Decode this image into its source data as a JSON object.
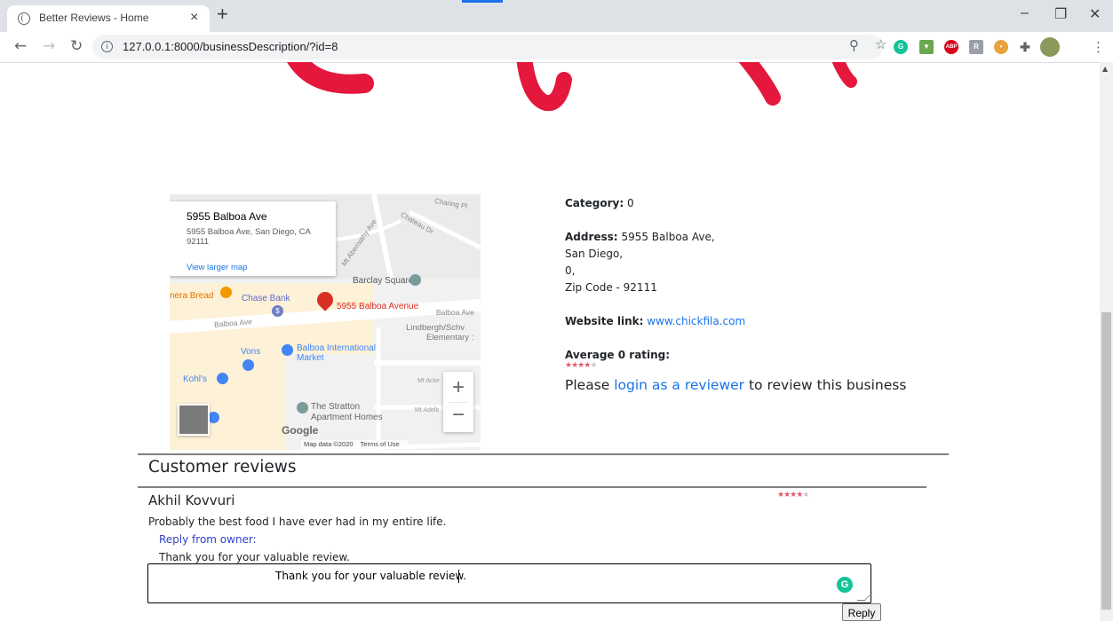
{
  "browser": {
    "tab_title": "Better Reviews - Home",
    "tab_close": "×",
    "new_tab": "+",
    "url": "127.0.0.1:8000/businessDescription/?id=8",
    "window_minimize": "–",
    "window_restore": "❐",
    "window_close": "✕",
    "extensions": [
      "grammarly-icon",
      "downloader-icon",
      "adblock-icon",
      "translate-icon",
      "cookie-icon",
      "puzzle-icon",
      "profile-avatar"
    ],
    "adblock_label": "ABP"
  },
  "map": {
    "card_title": "5955 Balboa Ave",
    "card_address": "5955 Balboa Ave, San Diego, CA 92111",
    "card_link": "View larger map",
    "pin_label": "5955 Balboa Avenue",
    "places": {
      "barclay": "Barclay Square",
      "chase": "Chase Bank",
      "panera": "nera Bread",
      "balboa_ave_left": "Balboa Ave",
      "balboa_ave_right": "Balboa Ave",
      "lindbergh": "Lindbergh/Schv",
      "elementary": "Elementary :",
      "vons": "Vons",
      "balboa_market": "Balboa International",
      "market": "Market",
      "kohls": "Kohl's",
      "stratton1": "The Stratton",
      "stratton2": "Apartment Homes",
      "charing": "Charing Pl",
      "chateau": "Chateau Dr",
      "abernathy": "Mt Abernathy Ave",
      "mt_acke": "Mt Acke",
      "mt_adelb": "Mt Adelb"
    },
    "google": "Google",
    "map_data": "Map data ©2020",
    "terms": "Terms of Use"
  },
  "business": {
    "category_label": "Category:",
    "category_value": "0",
    "address_label": "Address:",
    "address_line1": "5955 Balboa Ave,",
    "address_line2": "San Diego,",
    "address_line3": "0,",
    "address_line4": "Zip Code - 92111",
    "website_label": "Website link:",
    "website_value": "www.chickfila.com",
    "rating_label": "Average 0 rating:",
    "rating_stars": 3.5,
    "login_prefix": "Please",
    "login_link": "login as a reviewer",
    "login_suffix": "to review this business"
  },
  "reviews": {
    "heading": "Customer reviews",
    "items": [
      {
        "reviewer": "Akhil Kovvuri",
        "stars": 3.5,
        "body": "Probably the best food I have ever had in my entire life.",
        "reply_label": "Reply from owner:",
        "reply_text": "Thank you for your valuable review.",
        "reply_input_value": "Thank you for your valuable review.",
        "reply_button": "Reply"
      }
    ]
  },
  "colors": {
    "link": "#1a73e8",
    "star_on": "#e05a6a",
    "star_off": "#c8c8c8",
    "logo_red": "#e4173d",
    "pin_red": "#d93025"
  }
}
